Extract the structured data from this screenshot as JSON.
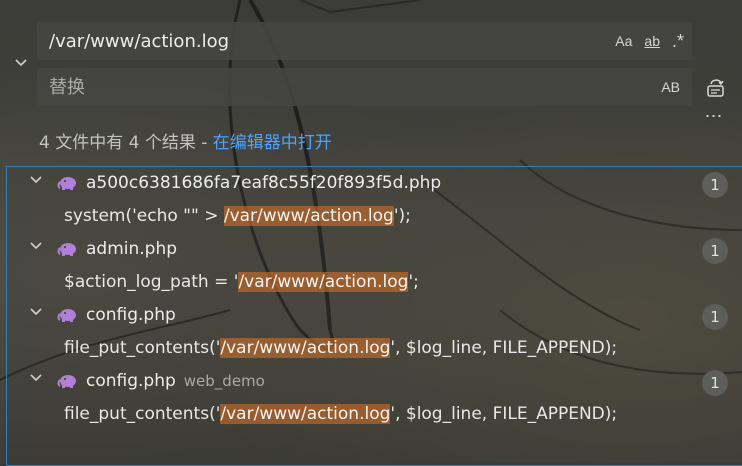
{
  "search": {
    "find_value": "/var/www/action.log",
    "find_options": {
      "match_case": "Aa",
      "match_word": "ab",
      "regex": ".*"
    },
    "replace_placeholder": "替换",
    "replace_options": {
      "preserve_case": "AB"
    }
  },
  "summary": {
    "text": "4 文件中有 4 个结果 - ",
    "open_in_editor": "在编辑器中打开"
  },
  "results": [
    {
      "file": "a500c6381686fa7eaf8c55f20f893f5d.php",
      "dir": "",
      "count": "1",
      "match": {
        "before": "system('echo \"\" > ",
        "term": "/var/www/action.log",
        "after": "');"
      }
    },
    {
      "file": "admin.php",
      "dir": "",
      "count": "1",
      "match": {
        "before": "$action_log_path = '",
        "term": "/var/www/action.log",
        "after": "';"
      }
    },
    {
      "file": "config.php",
      "dir": "",
      "count": "1",
      "match": {
        "before": "file_put_contents('",
        "term": "/var/www/action.log",
        "after": "', $log_line, FILE_APPEND);"
      }
    },
    {
      "file": "config.php",
      "dir": "web_demo",
      "count": "1",
      "match": {
        "before": "file_put_contents('",
        "term": "/var/www/action.log",
        "after": "', $log_line, FILE_APPEND);"
      }
    }
  ],
  "colors": {
    "accent": "#4da3ff",
    "highlight": "#cd6e28",
    "php_icon": "#b07fd6",
    "results_border": "#2f7fc1"
  },
  "icons": {
    "collapse": "chevron-down-icon",
    "file_expand": "chevron-down-icon",
    "file_type": "php-elephant-icon",
    "preserve_case_toggle": "replace-all-icon",
    "more": "ellipsis-icon"
  }
}
